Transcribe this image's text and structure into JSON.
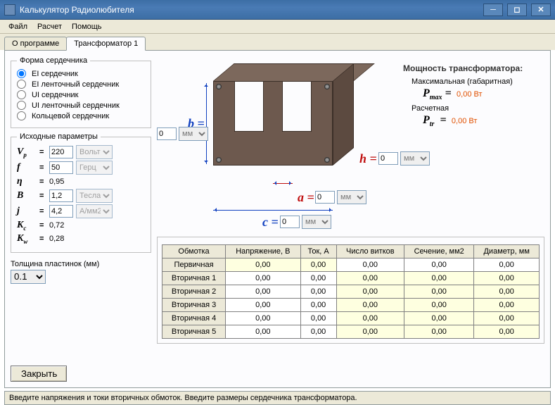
{
  "window": {
    "title": "Калькулятор Радиолюбителя"
  },
  "menu": {
    "file": "Файл",
    "calc": "Расчет",
    "help": "Помощь"
  },
  "tabs": {
    "about": "О программе",
    "trans": "Трансформатор 1"
  },
  "core_shape": {
    "legend": "Форма сердечника",
    "opts": {
      "ei": "EI сердечник",
      "eit": "EI ленточный сердечник",
      "ui": "UI сердечник",
      "uit": "UI ленточный сердечник",
      "ring": "Кольцевой сердечник"
    }
  },
  "params": {
    "legend": "Исходные параметры",
    "Vp": {
      "sym": "V",
      "sub": "p",
      "val": "220",
      "unit": "Вольт"
    },
    "f": {
      "sym": "f",
      "sub": "",
      "val": "50",
      "unit": "Герц"
    },
    "eta": {
      "sym": "η",
      "sub": "",
      "val": "0,95"
    },
    "B": {
      "sym": "B",
      "sub": "",
      "val": "1,2",
      "unit": "Тесла"
    },
    "J": {
      "sym": "j",
      "sub": "",
      "val": "4,2",
      "unit": "А/мм2"
    },
    "Kc": {
      "sym": "K",
      "sub": "c",
      "val": "0,72"
    },
    "Kw": {
      "sym": "K",
      "sub": "w",
      "val": "0,28"
    }
  },
  "plate": {
    "label": "Толщина пластинок (мм)",
    "val": "0.1"
  },
  "close_btn": "Закрыть",
  "dims": {
    "b": {
      "label": "b =",
      "val": "0",
      "unit": "мм"
    },
    "a": {
      "label": "a =",
      "val": "0",
      "unit": "мм"
    },
    "c": {
      "label": "c =",
      "val": "0",
      "unit": "мм"
    },
    "h": {
      "label": "h =",
      "val": "0",
      "unit": "мм"
    }
  },
  "power": {
    "hdr": "Мощность трансформатора:",
    "max_lbl": "Максимальная (габаритная)",
    "max_sym": "P",
    "max_sub": "max",
    "max_val": "0,00 Вт",
    "calc_lbl": "Расчетная",
    "calc_sym": "P",
    "calc_sub": "tr",
    "calc_val": "0,00 Вт"
  },
  "table": {
    "cols": {
      "w": "Обмотка",
      "v": "Напряжение, В",
      "i": "Ток, А",
      "n": "Число витков",
      "s": "Сечение, мм2",
      "d": "Диаметр, мм"
    },
    "rows": [
      {
        "name": "Первичная",
        "v": "0,00",
        "i": "0,00",
        "n": "0,00",
        "s": "0,00",
        "d": "0,00"
      },
      {
        "name": "Вторичная 1",
        "v": "0,00",
        "i": "0,00",
        "n": "0,00",
        "s": "0,00",
        "d": "0,00"
      },
      {
        "name": "Вторичная 2",
        "v": "0,00",
        "i": "0,00",
        "n": "0,00",
        "s": "0,00",
        "d": "0,00"
      },
      {
        "name": "Вторичная 3",
        "v": "0,00",
        "i": "0,00",
        "n": "0,00",
        "s": "0,00",
        "d": "0,00"
      },
      {
        "name": "Вторичная 4",
        "v": "0,00",
        "i": "0,00",
        "n": "0,00",
        "s": "0,00",
        "d": "0,00"
      },
      {
        "name": "Вторичная 5",
        "v": "0,00",
        "i": "0,00",
        "n": "0,00",
        "s": "0,00",
        "d": "0,00"
      }
    ]
  },
  "status": "Введите напряжения и токи вторичных обмоток. Введите размеры сердечника трансформатора."
}
